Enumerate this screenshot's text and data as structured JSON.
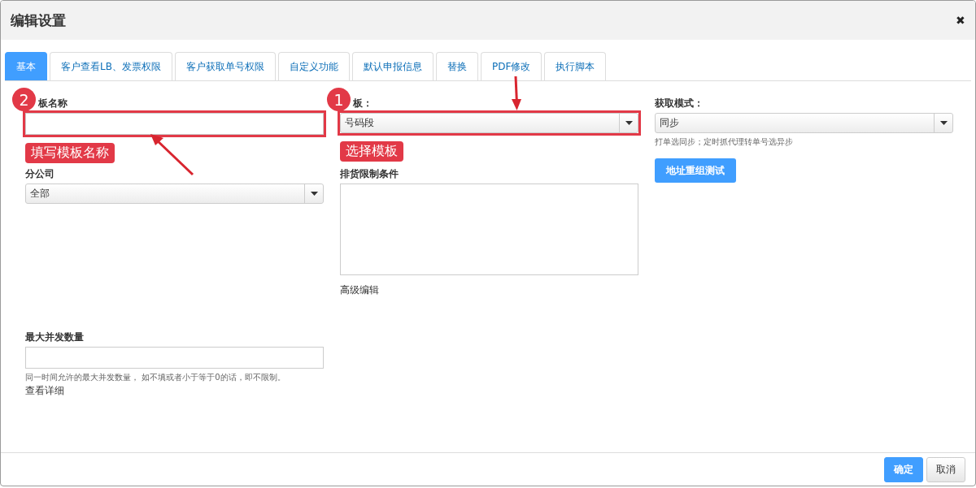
{
  "dialog": {
    "title": "编辑设置",
    "close": "✖"
  },
  "tabs": [
    {
      "label": "基本",
      "selected": true
    },
    {
      "label": "客户查看LB、发票权限",
      "selected": false
    },
    {
      "label": "客户获取单号权限",
      "selected": false
    },
    {
      "label": "自定义功能",
      "selected": false
    },
    {
      "label": "默认申报信息",
      "selected": false
    },
    {
      "label": "替换",
      "selected": false
    },
    {
      "label": "PDF修改",
      "selected": false
    },
    {
      "label": "执行脚本",
      "selected": false
    }
  ],
  "rows": [
    [
      {
        "kind": "input",
        "label": "板名称",
        "annotation": {
          "number": "2",
          "label": "填写模板名称"
        }
      },
      {
        "kind": "select",
        "label": "板：",
        "value": "号码段",
        "annotation": {
          "number": "1",
          "label": "选择模板"
        }
      },
      {
        "kind": "select",
        "label": "获取模式：",
        "value": "同步",
        "hint": "打单选同步；定时抓代理转单号选异步"
      }
    ],
    [
      {
        "kind": "select",
        "label": "分公司",
        "value": "全部"
      },
      {
        "kind": "textarea",
        "label": "排货限制条件",
        "link": "高级编辑"
      },
      {
        "kind": "button",
        "text": "地址重组测试"
      }
    ],
    [
      {
        "kind": "input",
        "label": "最大并发数量",
        "hint": "同一时间允许的最大并发数量， 如不填或者小于等于0的话，即不限制。",
        "link": "查看详细"
      }
    ]
  ],
  "footer": {
    "buttons": [
      {
        "text": "确定",
        "kind": "primary"
      },
      {
        "text": "取消",
        "kind": "default"
      }
    ]
  }
}
